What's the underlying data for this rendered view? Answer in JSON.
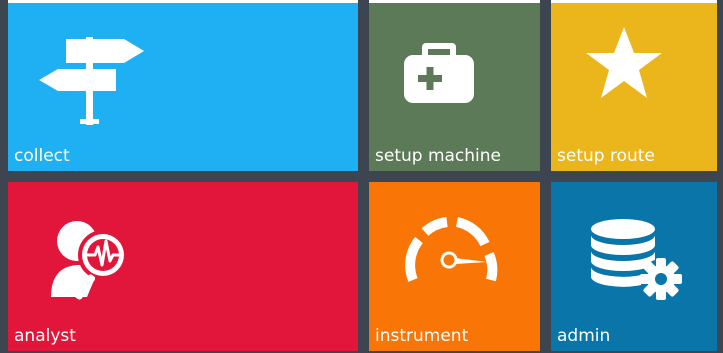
{
  "tiles": {
    "collect": {
      "label": "collect",
      "icon": "signpost-icon",
      "color": "#1fb0f4"
    },
    "setup_machine": {
      "label": "setup machine",
      "icon": "medical-case-icon",
      "color": "#5c7a57"
    },
    "setup_route": {
      "label": "setup route",
      "icon": "star-icon",
      "color": "#ebb51c"
    },
    "analyst": {
      "label": "analyst",
      "icon": "analyst-magnifier-icon",
      "color": "#e2163a"
    },
    "instrument": {
      "label": "instrument",
      "icon": "gauge-icon",
      "color": "#f97606"
    },
    "admin": {
      "label": "admin",
      "icon": "database-gear-icon",
      "color": "#0a75a8"
    }
  }
}
